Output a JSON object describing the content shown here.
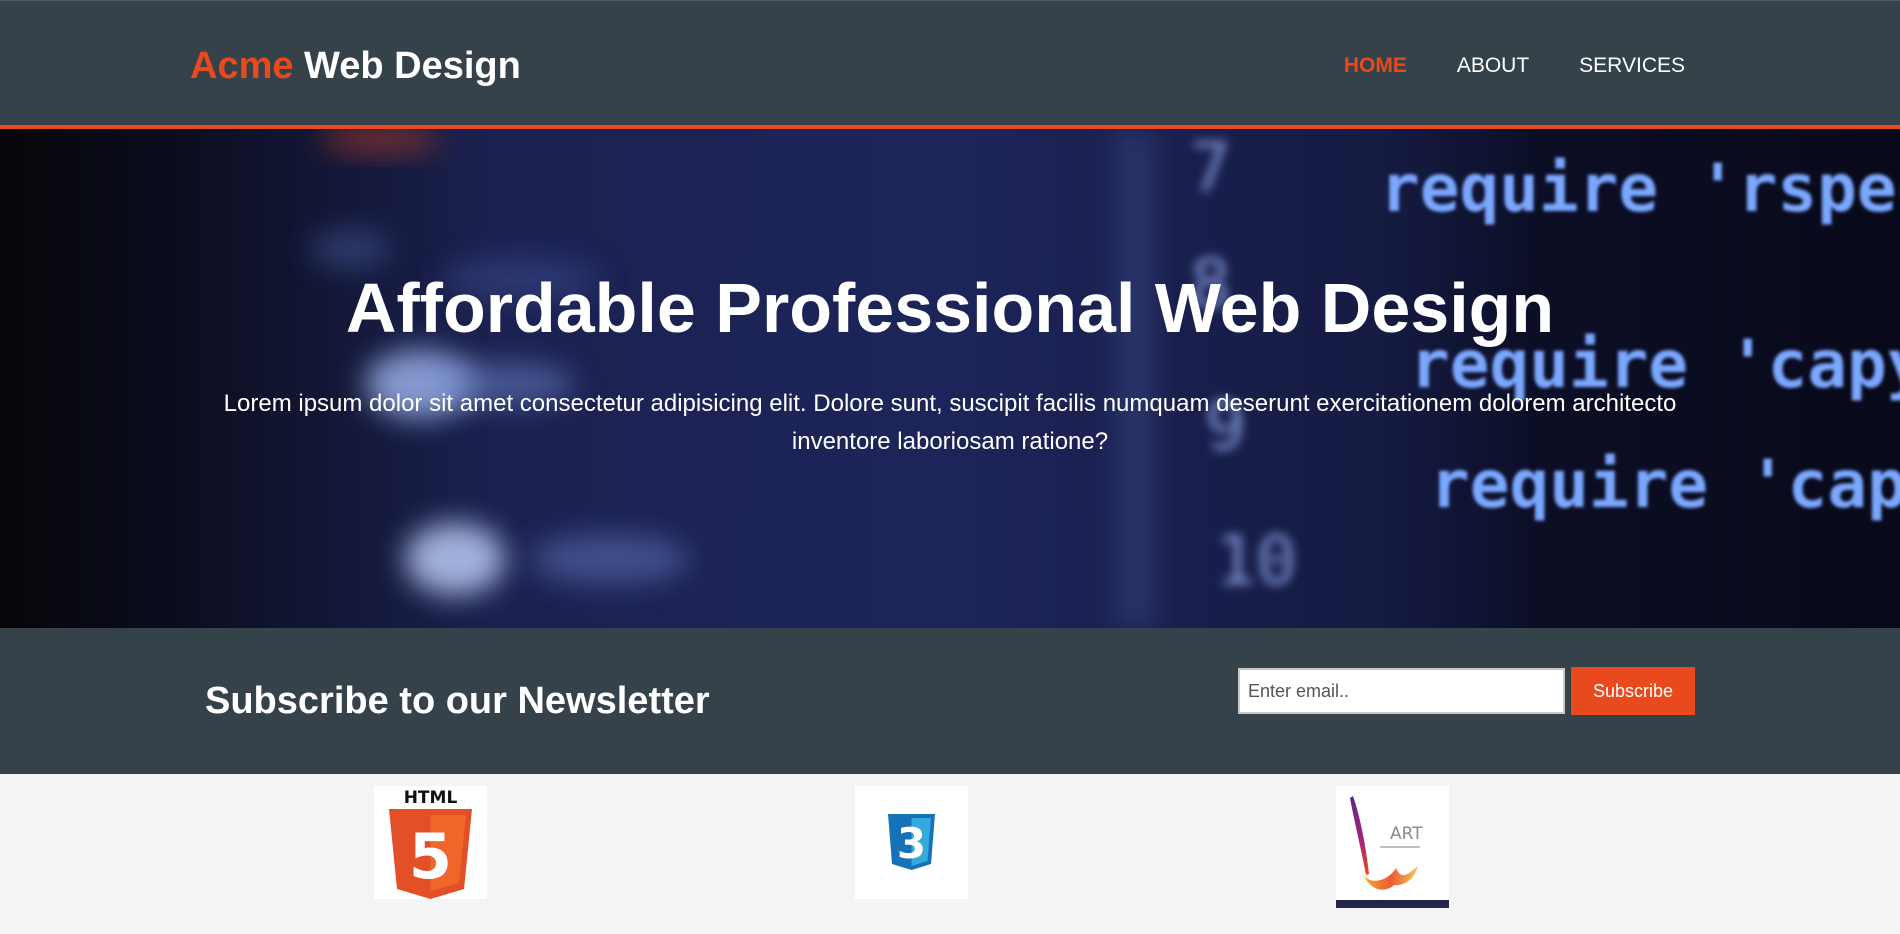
{
  "header": {
    "brand_accent": "Acme",
    "brand_rest": " Web Design",
    "nav": [
      {
        "label": "HOME",
        "active": true
      },
      {
        "label": "ABOUT",
        "active": false
      },
      {
        "label": "SERVICES",
        "active": false
      }
    ]
  },
  "showcase": {
    "title": "Affordable Professional Web Design",
    "text": "Lorem ipsum dolor sit amet consectetur adipisicing elit. Dolore sunt, suscipit facilis numquam deserunt exercitationem dolorem architecto inventore laboriosam ratione?",
    "background_code": {
      "line_numbers": [
        "7",
        "8",
        "9",
        "10"
      ],
      "lines": [
        "require 'rspec/re",
        "require 'capyba",
        "require 'capybo"
      ]
    }
  },
  "newsletter": {
    "title": "Subscribe to our Newsletter",
    "email_placeholder": "Enter email..",
    "button_label": "Subscribe"
  },
  "boxes": {
    "html5_logo_text": "HTML",
    "html5_number": "5",
    "css3_number": "3",
    "art_logo_text": "ART"
  },
  "colors": {
    "dark": "#35424a",
    "accent": "#e8491d",
    "light_bg": "#f4f4f4",
    "code_green": "#7dff4f",
    "code_blue": "#7aa7ff"
  }
}
